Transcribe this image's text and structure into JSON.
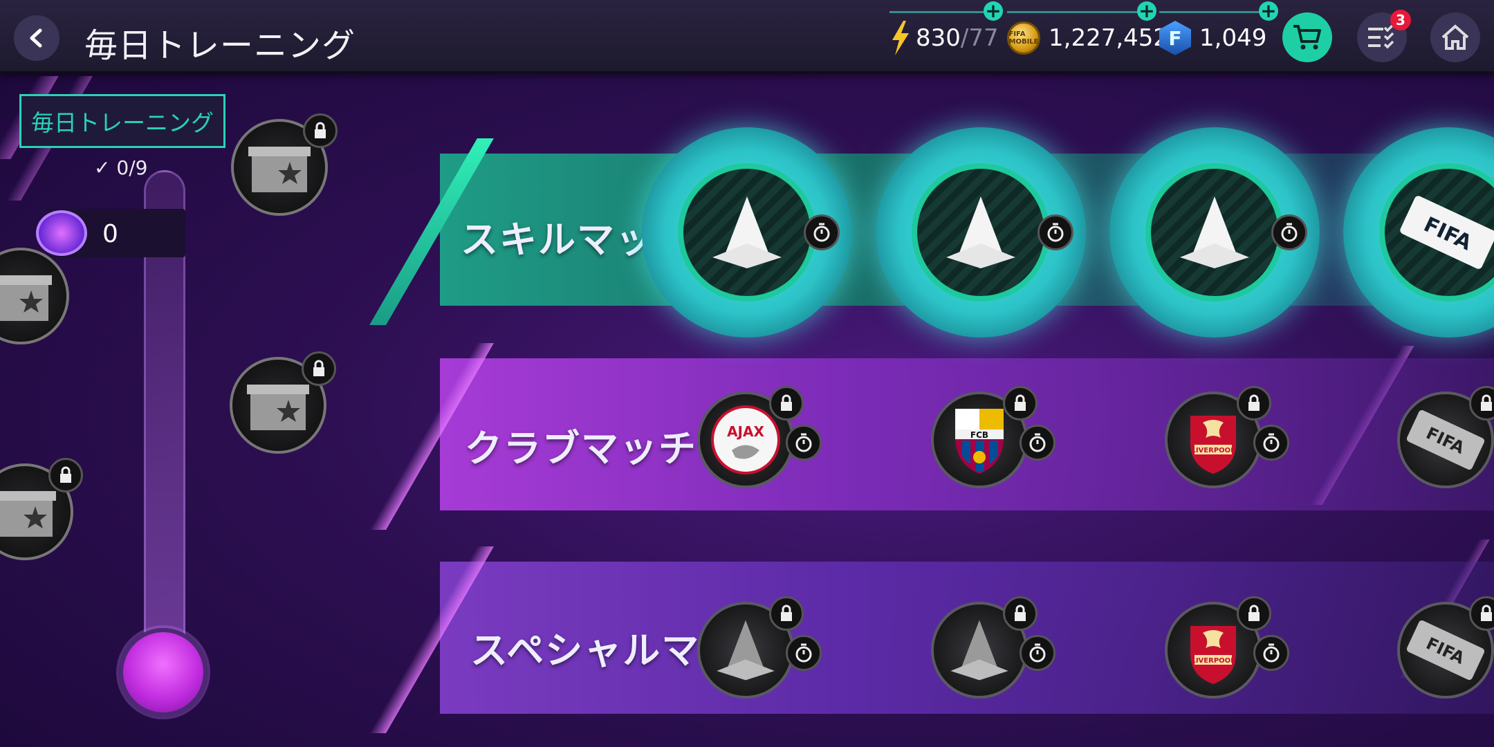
{
  "header": {
    "title": "毎日トレーニング",
    "energy": "830",
    "energy_max": "/77",
    "coins": "1,227,452",
    "coin_label": "FIFA MOBILE",
    "fifa_points": "1,049",
    "fp_letter": "F",
    "tasks_badge": "3",
    "plus_symbol": "+"
  },
  "left_panel": {
    "tab_label": "毎日トレーニング",
    "progress": "0/9",
    "whistle_count": "0"
  },
  "rows": {
    "skill": {
      "title": "スキルマッチ",
      "ticket_text": "FIFA"
    },
    "club": {
      "title": "クラブマッチ",
      "clubs": [
        "AJAX",
        "FCB",
        "LIVERPOOL"
      ],
      "ticket_text": "FIFA"
    },
    "special": {
      "title": "スペシャルマッチ",
      "club": "LIVERPOOL",
      "ticket_text": "FIFA"
    }
  },
  "colors": {
    "accent": "#1ecfa6",
    "teal_glow": "#4fe6e0",
    "purple": "#a63bd6"
  }
}
